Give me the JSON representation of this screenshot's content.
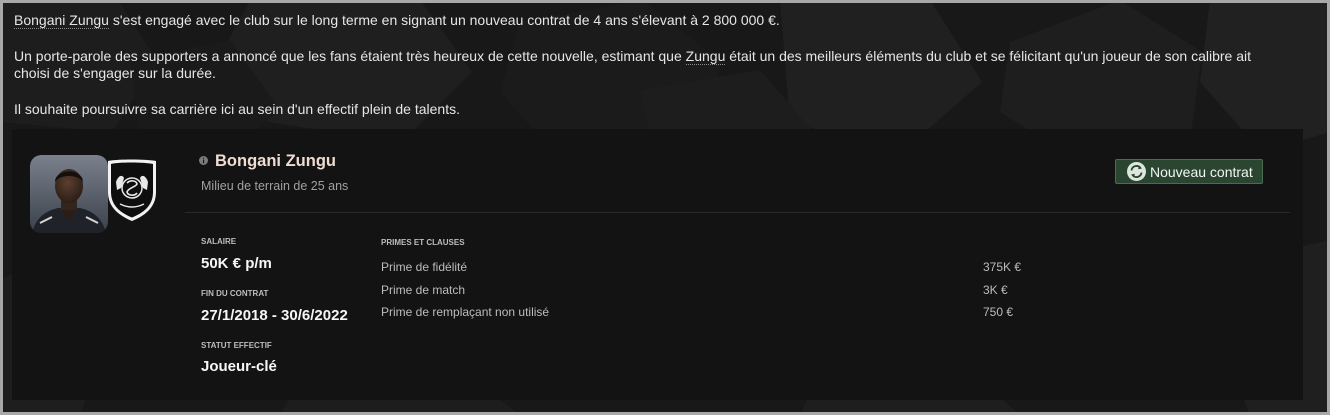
{
  "news": {
    "paragraph_1": {
      "player_link": "Bongani Zungu",
      "text_after_link": " s'est engagé avec le club sur le long terme en signant un nouveau contrat de 4 ans s'élevant à 2 800 000 €."
    },
    "paragraph_2": {
      "text_before_link": "Un porte-parole des supporters a annoncé que les fans étaient très heureux de cette nouvelle, estimant que ",
      "player_link": "Zungu",
      "text_after_link": " était un des meilleurs éléments du club et se félicitant qu'un joueur de son calibre ait choisi de s'engager sur la durée."
    },
    "paragraph_3": "Il souhaite poursuivre sa carrière ici au sein d'un effectif plein de talents."
  },
  "player": {
    "name": "Bongani Zungu",
    "subtitle": "Milieu de terrain de 25 ans",
    "photo_icon": "player-photo",
    "club_badge_icon": "club-badge-icon",
    "info_icon": "info-icon"
  },
  "actions": {
    "new_contract": {
      "label": "Nouveau contrat",
      "icon": "refresh-arrows-icon"
    }
  },
  "contract": {
    "salary": {
      "label": "SALAIRE",
      "value": "50K € p/m"
    },
    "end": {
      "label": "FIN DU CONTRAT",
      "value": "27/1/2018 - 30/6/2022"
    },
    "squad_status": {
      "label": "STATUT EFFECTIF",
      "value": "Joueur-clé"
    }
  },
  "bonuses": {
    "title": "PRIMES ET CLAUSES",
    "rows": [
      {
        "label": "Prime de fidélité",
        "value": "375K €"
      },
      {
        "label": "Prime de match",
        "value": "3K €"
      },
      {
        "label": "Prime de remplaçant non utilisé",
        "value": "750 €"
      }
    ]
  },
  "colors": {
    "background": "#181818",
    "card": "#131313",
    "text": "#e6e6e6",
    "player_name": "#f0dcd2",
    "muted": "#a0a0a0",
    "button_bg": "#2a4631",
    "button_border": "#4a6d51"
  }
}
